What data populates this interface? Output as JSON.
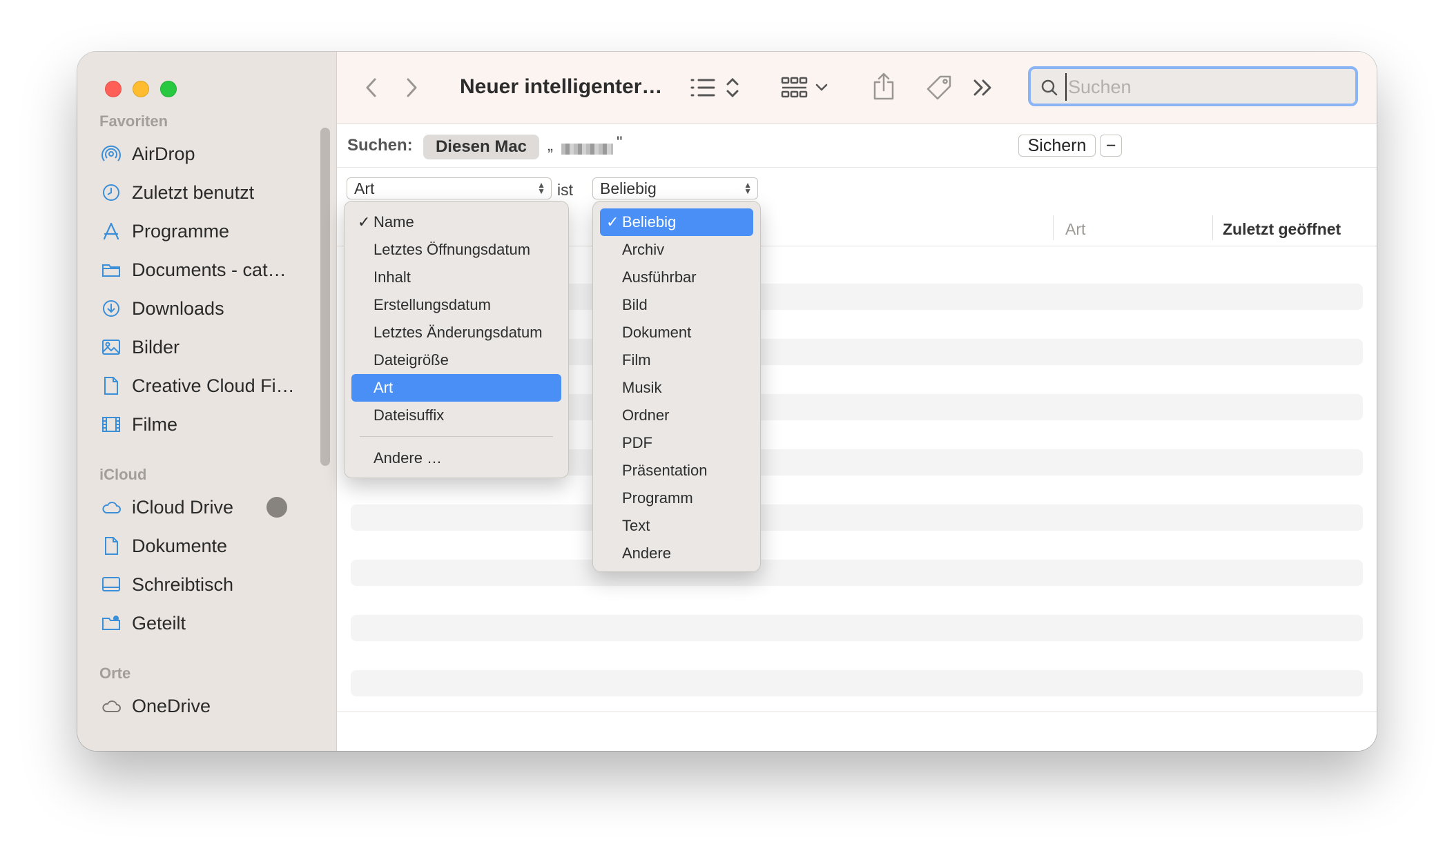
{
  "window": {
    "title": "Neuer intelligenter…"
  },
  "sidebar": {
    "sections": [
      {
        "title": "Favoriten"
      },
      {
        "title": "iCloud"
      },
      {
        "title": "Orte"
      }
    ],
    "favorites": [
      {
        "label": "AirDrop",
        "icon": "airdrop-icon"
      },
      {
        "label": "Zuletzt benutzt",
        "icon": "clock-icon"
      },
      {
        "label": "Programme",
        "icon": "apps-icon"
      },
      {
        "label": "Documents - cat…",
        "icon": "folder-icon"
      },
      {
        "label": "Downloads",
        "icon": "download-icon"
      },
      {
        "label": "Bilder",
        "icon": "photo-icon"
      },
      {
        "label": "Creative Cloud Fi…",
        "icon": "document-icon"
      },
      {
        "label": "Filme",
        "icon": "film-icon"
      }
    ],
    "icloud": [
      {
        "label": "iCloud Drive",
        "icon": "cloud-icon"
      },
      {
        "label": "Dokumente",
        "icon": "document-icon"
      },
      {
        "label": "Schreibtisch",
        "icon": "desktop-icon"
      },
      {
        "label": "Geteilt",
        "icon": "shared-folder-icon"
      }
    ],
    "places": [
      {
        "label": "OneDrive",
        "icon": "cloud-icon"
      }
    ]
  },
  "search": {
    "placeholder": "Suchen",
    "value": ""
  },
  "scope": {
    "label": "Suchen:",
    "selected": "Diesen Mac",
    "term_prefix": "„",
    "term_suffix": "\"",
    "save_label": "Sichern",
    "minus_label": "−",
    "plus_label": "+"
  },
  "rule": {
    "attribute": "Art",
    "operator": "ist",
    "value": "Beliebig"
  },
  "columns": {
    "art": "Art",
    "last_opened": "Zuletzt geöffnet"
  },
  "attribute_menu": {
    "items": [
      {
        "label": "Name",
        "checked": true,
        "highlighted": false
      },
      {
        "label": "Letztes Öffnungsdatum",
        "checked": false,
        "highlighted": false
      },
      {
        "label": "Inhalt",
        "checked": false,
        "highlighted": false
      },
      {
        "label": "Erstellungsdatum",
        "checked": false,
        "highlighted": false
      },
      {
        "label": "Letztes Änderungsdatum",
        "checked": false,
        "highlighted": false
      },
      {
        "label": "Dateigröße",
        "checked": false,
        "highlighted": false
      },
      {
        "label": "Art",
        "checked": false,
        "highlighted": true
      },
      {
        "label": "Dateisuffix",
        "checked": false,
        "highlighted": false
      }
    ],
    "other": "Andere …"
  },
  "kind_menu": {
    "items": [
      {
        "label": "Beliebig",
        "checked": true,
        "highlighted": true
      },
      {
        "label": "Archiv"
      },
      {
        "label": "Ausführbar"
      },
      {
        "label": "Bild"
      },
      {
        "label": "Dokument"
      },
      {
        "label": "Film"
      },
      {
        "label": "Musik"
      },
      {
        "label": "Ordner"
      },
      {
        "label": "PDF"
      },
      {
        "label": "Präsentation"
      },
      {
        "label": "Programm"
      },
      {
        "label": "Text"
      },
      {
        "label": "Andere"
      }
    ]
  },
  "checkmark": "✓",
  "colors": {
    "accent": "#4a8ff5",
    "sidebar_icon": "#3b8fd9",
    "traffic_red": "#ff5f57",
    "traffic_yellow": "#febc2e",
    "traffic_green": "#28c840"
  }
}
